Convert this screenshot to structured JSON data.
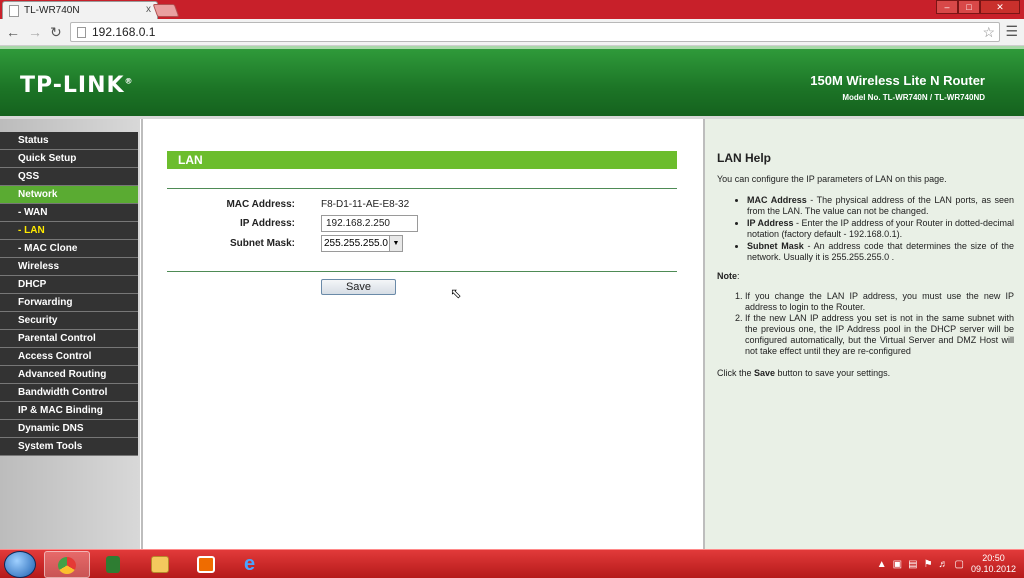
{
  "browser": {
    "tab_title": "TL-WR740N",
    "tab_close": "x",
    "url": "192.168.0.1"
  },
  "header": {
    "logo": "TP-LINK",
    "logo_mark": "®",
    "product": "150M Wireless Lite N Router",
    "model": "Model No. TL-WR740N / TL-WR740ND"
  },
  "sidebar": {
    "items": [
      {
        "label": "Status"
      },
      {
        "label": "Quick Setup"
      },
      {
        "label": "QSS"
      },
      {
        "label": "Network"
      },
      {
        "label": "- WAN"
      },
      {
        "label": "- LAN"
      },
      {
        "label": "- MAC Clone"
      },
      {
        "label": "Wireless"
      },
      {
        "label": "DHCP"
      },
      {
        "label": "Forwarding"
      },
      {
        "label": "Security"
      },
      {
        "label": "Parental Control"
      },
      {
        "label": "Access Control"
      },
      {
        "label": "Advanced Routing"
      },
      {
        "label": "Bandwidth Control"
      },
      {
        "label": "IP & MAC Binding"
      },
      {
        "label": "Dynamic DNS"
      },
      {
        "label": "System Tools"
      }
    ]
  },
  "main": {
    "section_title": "LAN",
    "mac_label": "MAC Address:",
    "mac_value": "F8-D1-11-AE-E8-32",
    "ip_label": "IP Address:",
    "ip_value": "192.168.2.250",
    "mask_label": "Subnet Mask:",
    "mask_value": "255.255.255.0",
    "save_label": "Save"
  },
  "help": {
    "title": "LAN Help",
    "intro": "You can configure the IP parameters of LAN on this page.",
    "items": [
      {
        "term": "MAC Address",
        "text": " - The physical address of the LAN ports, as seen from the LAN. The value can not be changed."
      },
      {
        "term": "IP Address",
        "text": " - Enter the IP address of your Router in dotted-decimal notation (factory default - 192.168.0.1)."
      },
      {
        "term": "Subnet Mask",
        "text": " - An address code that determines the size of the network. Usually it is 255.255.255.0 ."
      }
    ],
    "note_label": "Note",
    "note_colon": ":",
    "notes": [
      "If you change the LAN IP address, you must use the new IP address to login to the Router.",
      "If the new LAN IP address you set is not in the same subnet with the previous one, the IP Address pool in the DHCP server will be configured automatically, but the Virtual Server and DMZ Host will not take effect until they are re-configured"
    ],
    "foot_pre": "Click the ",
    "foot_bold": "Save",
    "foot_post": " button to save your settings."
  },
  "taskbar": {
    "time": "20:50",
    "date": "09.10.2012"
  },
  "colors": {
    "header_green": "#1c7426",
    "section_green": "#6cbd2d",
    "menu_dark": "#333333",
    "menu_active": "#5aab32",
    "help_bg": "#e9f0e6",
    "taskbar_red": "#c8202a"
  }
}
